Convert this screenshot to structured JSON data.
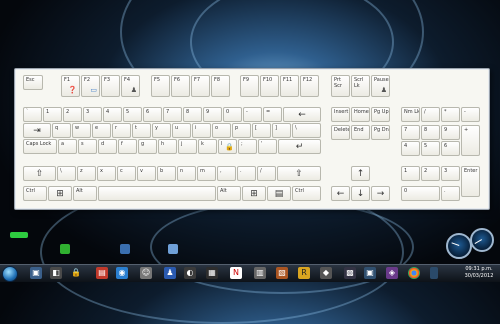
{
  "taskbar": {
    "clock_time": "09:31 p.m.",
    "clock_date": "30/03/2012"
  },
  "keyboard": {
    "function_row": [
      "Esc",
      "F1",
      "F2",
      "F3",
      "F4",
      "F5",
      "F6",
      "F7",
      "F8",
      "F9",
      "F10",
      "F11",
      "F12",
      "Prt Scr",
      "Scrl Lk",
      "Pause"
    ],
    "number_row": [
      "`",
      "1",
      "2",
      "3",
      "4",
      "5",
      "6",
      "7",
      "8",
      "9",
      "0",
      "-",
      "=",
      "←"
    ],
    "qwerty_row": [
      "⇥",
      "q",
      "w",
      "e",
      "r",
      "t",
      "y",
      "u",
      "i",
      "o",
      "p",
      "[",
      "]",
      "\\"
    ],
    "home_row": [
      "Caps Lock",
      "a",
      "s",
      "d",
      "f",
      "g",
      "h",
      "j",
      "k",
      "l",
      ";",
      "'",
      "↵"
    ],
    "shift_row": [
      "⇧",
      "\\",
      "z",
      "x",
      "c",
      "v",
      "b",
      "n",
      "m",
      ",",
      ".",
      "/",
      "⇧"
    ],
    "bottom_row": [
      "Ctrl",
      "⊞",
      "Alt",
      "",
      "Alt",
      "⊞",
      "▤",
      "Ctrl"
    ],
    "nav_top": [
      "Insert",
      "Home",
      "Pg Up"
    ],
    "nav_bottom": [
      "Delete",
      "End",
      "Pg Dn"
    ],
    "arrows": [
      "↑",
      "←",
      "↓",
      "→"
    ],
    "numpad": [
      "Nm Lk",
      "/",
      "*",
      "-",
      "7",
      "8",
      "9",
      "+",
      "4",
      "5",
      "6",
      "1",
      "2",
      "3",
      "Enter",
      "0",
      "."
    ]
  }
}
